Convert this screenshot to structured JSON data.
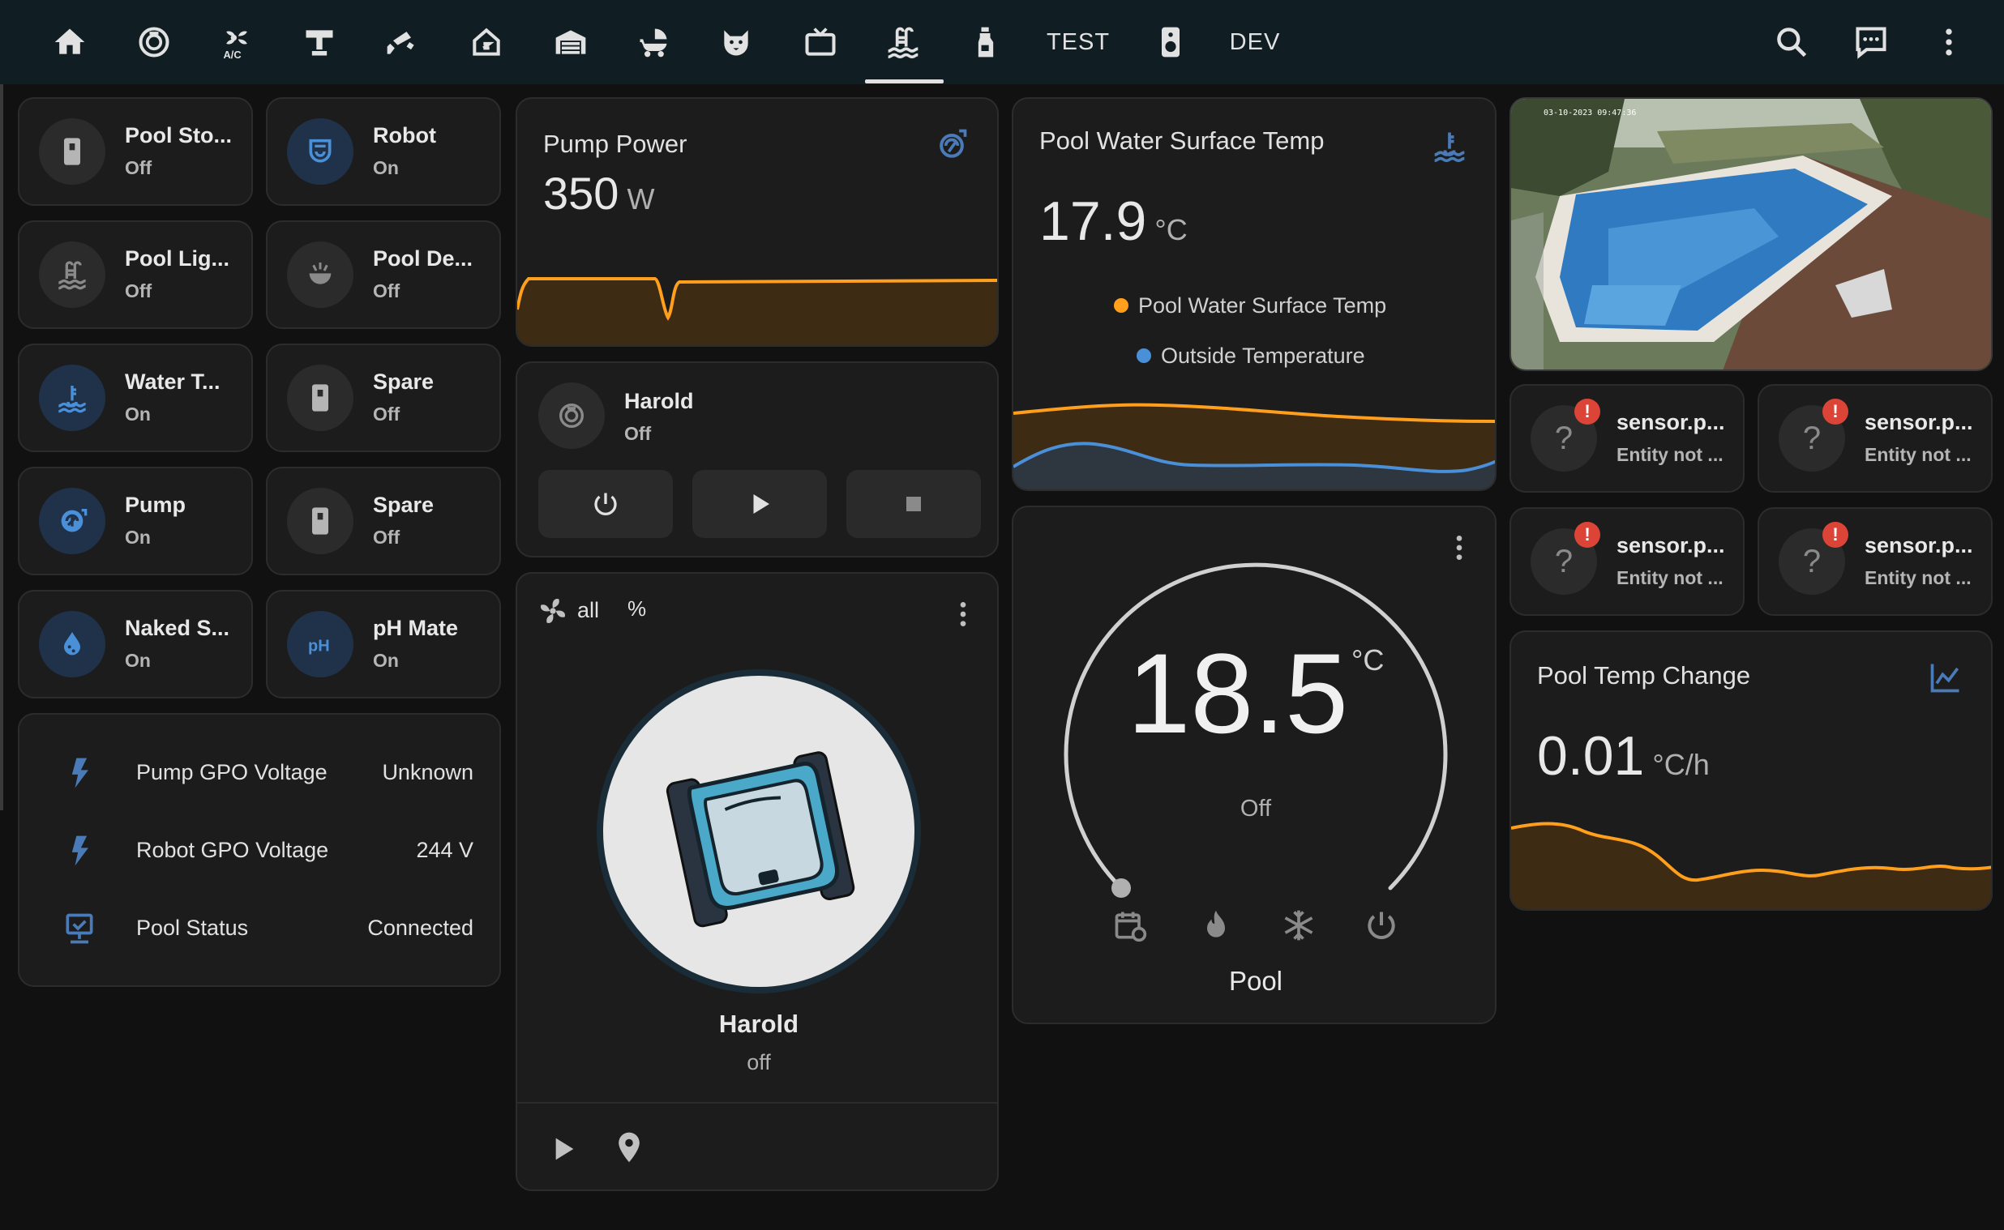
{
  "nav": {
    "tabs": [
      {
        "icon": "home-icon"
      },
      {
        "icon": "robot-vacuum-icon"
      },
      {
        "icon": "air-conditioner-icon"
      },
      {
        "icon": "desk-lamp-icon"
      },
      {
        "icon": "cctv-icon"
      },
      {
        "icon": "home-floor-icon"
      },
      {
        "icon": "garage-icon"
      },
      {
        "icon": "baby-carriage-icon"
      },
      {
        "icon": "cat-icon"
      },
      {
        "icon": "television-icon"
      },
      {
        "icon": "pool-icon",
        "active": true
      },
      {
        "icon": "spray-bottle-icon"
      }
    ],
    "test_label": "TEST",
    "speaker_icon": "speaker-icon",
    "dev_label": "DEV",
    "actions": [
      "search-icon",
      "assist-icon",
      "menu-dots-icon"
    ]
  },
  "tiles": [
    {
      "name": "Pool Sto...",
      "state": "Off",
      "icon": "outlet-icon",
      "active": false
    },
    {
      "name": "Robot",
      "state": "On",
      "icon": "robot-vacuum-icon",
      "active": true
    },
    {
      "name": "Pool Lig...",
      "state": "Off",
      "icon": "pool-light-icon",
      "active": false
    },
    {
      "name": "Pool De...",
      "state": "Off",
      "icon": "pool-deco-icon",
      "active": false
    },
    {
      "name": "Water T...",
      "state": "On",
      "icon": "water-thermometer-icon",
      "active": true
    },
    {
      "name": "Spare",
      "state": "Off",
      "icon": "outlet-icon",
      "active": false
    },
    {
      "name": "Pump",
      "state": "On",
      "icon": "pump-icon",
      "active": true
    },
    {
      "name": "Spare",
      "state": "Off",
      "icon": "outlet-icon",
      "active": false
    },
    {
      "name": "Naked S...",
      "state": "On",
      "icon": "water-drop-icon",
      "active": true
    },
    {
      "name": "pH Mate",
      "state": "On",
      "icon": "ph-icon",
      "active": true
    }
  ],
  "entities": [
    {
      "name": "Pump GPO Voltage",
      "value": "Unknown",
      "icon": "flash-icon"
    },
    {
      "name": "Robot GPO Voltage",
      "value": "244 V",
      "icon": "flash-icon"
    },
    {
      "name": "Pool Status",
      "value": "Connected",
      "icon": "monitor-check-icon"
    }
  ],
  "pump_power": {
    "title": "Pump Power",
    "value": "350",
    "unit": "W",
    "icon": "pump-icon"
  },
  "harold_control": {
    "name": "Harold",
    "state": "Off",
    "buttons": [
      "power-icon",
      "play-icon",
      "stop-icon"
    ]
  },
  "harold_vacuum": {
    "fan_label": "all",
    "percent_label": "%",
    "name": "Harold",
    "state": "off"
  },
  "water_temp": {
    "title": "Pool Water Surface Temp",
    "value": "17.9",
    "unit": "°C",
    "legend": [
      "Pool Water Surface Temp",
      "Outside Temperature"
    ],
    "colors": {
      "primary": "#ff9f1c",
      "secondary": "#4a90d9"
    }
  },
  "thermostat": {
    "value": "18.5",
    "unit": "°C",
    "state": "Off",
    "name": "Pool",
    "modes": [
      "calendar-sync-icon",
      "fire-icon",
      "snowflake-icon",
      "power-icon"
    ]
  },
  "unknown_sensors": [
    {
      "name": "sensor.p...",
      "state": "Entity not ..."
    },
    {
      "name": "sensor.p...",
      "state": "Entity not ..."
    },
    {
      "name": "sensor.p...",
      "state": "Entity not ..."
    },
    {
      "name": "sensor.p...",
      "state": "Entity not ..."
    }
  ],
  "temp_change": {
    "title": "Pool Temp Change",
    "value": "0.01",
    "unit": "°C/h",
    "icon": "chart-line-icon"
  },
  "colors": {
    "accent": "#ff9f1c",
    "blue": "#4a90d9",
    "bg": "#111111",
    "card": "#1c1c1c",
    "topbar": "#101e24"
  }
}
